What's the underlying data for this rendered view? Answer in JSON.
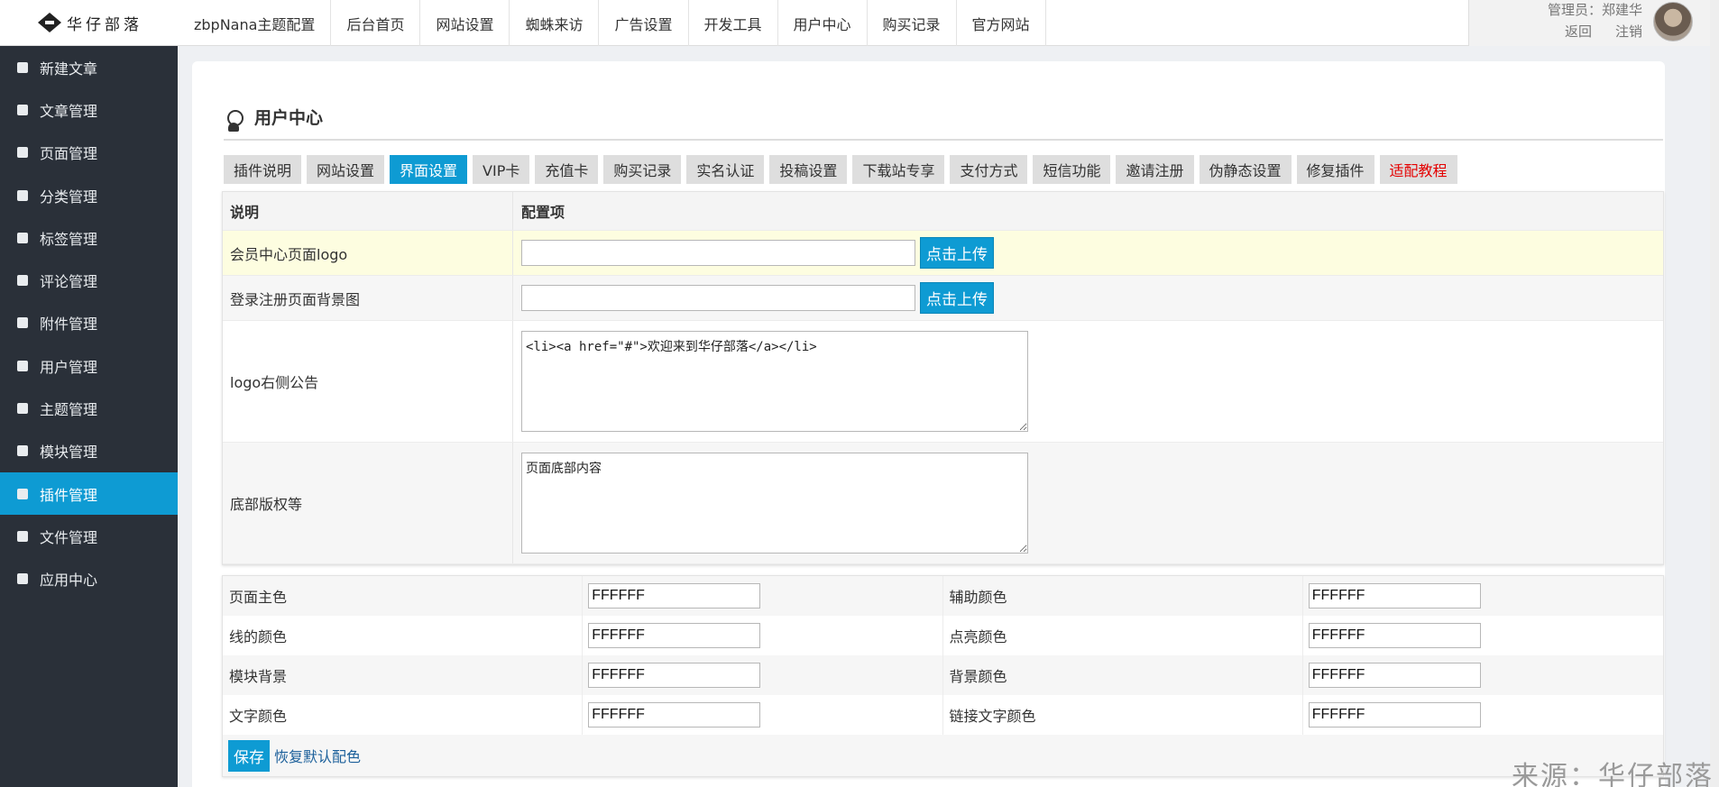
{
  "logo": {
    "text": "华仔部落"
  },
  "sidebar": {
    "items": [
      {
        "label": "新建文章",
        "icon": "edit-icon"
      },
      {
        "label": "文章管理",
        "icon": "document-icon"
      },
      {
        "label": "页面管理",
        "icon": "pages-icon"
      },
      {
        "label": "分类管理",
        "icon": "folder-icon"
      },
      {
        "label": "标签管理",
        "icon": "tag-icon"
      },
      {
        "label": "评论管理",
        "icon": "comment-icon"
      },
      {
        "label": "附件管理",
        "icon": "attachment-icon"
      },
      {
        "label": "用户管理",
        "icon": "user-icon"
      },
      {
        "label": "主题管理",
        "icon": "theme-icon"
      },
      {
        "label": "模块管理",
        "icon": "module-icon"
      },
      {
        "label": "插件管理",
        "icon": "plugin-icon",
        "active": true
      },
      {
        "label": "文件管理",
        "icon": "file-icon"
      },
      {
        "label": "应用中心",
        "icon": "app-center-icon"
      }
    ]
  },
  "topnav": {
    "items": [
      "zbpNana主题配置",
      "后台首页",
      "网站设置",
      "蜘蛛来访",
      "广告设置",
      "开发工具",
      "用户中心",
      "购买记录",
      "官方网站"
    ]
  },
  "user": {
    "admin_label": "管理员：郑建华",
    "back": "返回",
    "logout": "注销"
  },
  "page": {
    "title": "用户中心",
    "tabs": [
      {
        "label": "插件说明"
      },
      {
        "label": "网站设置"
      },
      {
        "label": "界面设置",
        "active": true
      },
      {
        "label": "VIP卡"
      },
      {
        "label": "充值卡"
      },
      {
        "label": "购买记录"
      },
      {
        "label": "实名认证"
      },
      {
        "label": "投稿设置"
      },
      {
        "label": "下载站专享"
      },
      {
        "label": "支付方式"
      },
      {
        "label": "短信功能"
      },
      {
        "label": "邀请注册"
      },
      {
        "label": "伪静态设置"
      },
      {
        "label": "修复插件"
      },
      {
        "label": "适配教程",
        "highlight": "#e40000"
      }
    ]
  },
  "config": {
    "col_desc": "说明",
    "col_item": "配置项",
    "upload_label": "点击上传",
    "rows": [
      {
        "label": "会员中心页面logo",
        "value": ""
      },
      {
        "label": "登录注册页面背景图",
        "value": ""
      },
      {
        "label": "logo右侧公告",
        "value": "<li><a href=\"#\">欢迎来到华仔部落</a></li>"
      },
      {
        "label": "底部版权等",
        "value": "页面底部内容"
      }
    ]
  },
  "colors": {
    "rows": [
      {
        "l1": "页面主色",
        "v1": "FFFFFF",
        "l2": "辅助颜色",
        "v2": "FFFFFF"
      },
      {
        "l1": "线的颜色",
        "v1": "FFFFFF",
        "l2": "点亮颜色",
        "v2": "FFFFFF"
      },
      {
        "l1": "模块背景",
        "v1": "FFFFFF",
        "l2": "背景颜色",
        "v2": "FFFFFF"
      },
      {
        "l1": "文字颜色",
        "v1": "FFFFFF",
        "l2": "链接文字颜色",
        "v2": "FFFFFF"
      }
    ],
    "save": "保存",
    "reset": "恢复默认配色"
  },
  "watermark": "来源：华仔部落",
  "theme": {
    "accent": "#0e9bd3",
    "sidebar_bg": "#2a3039"
  }
}
